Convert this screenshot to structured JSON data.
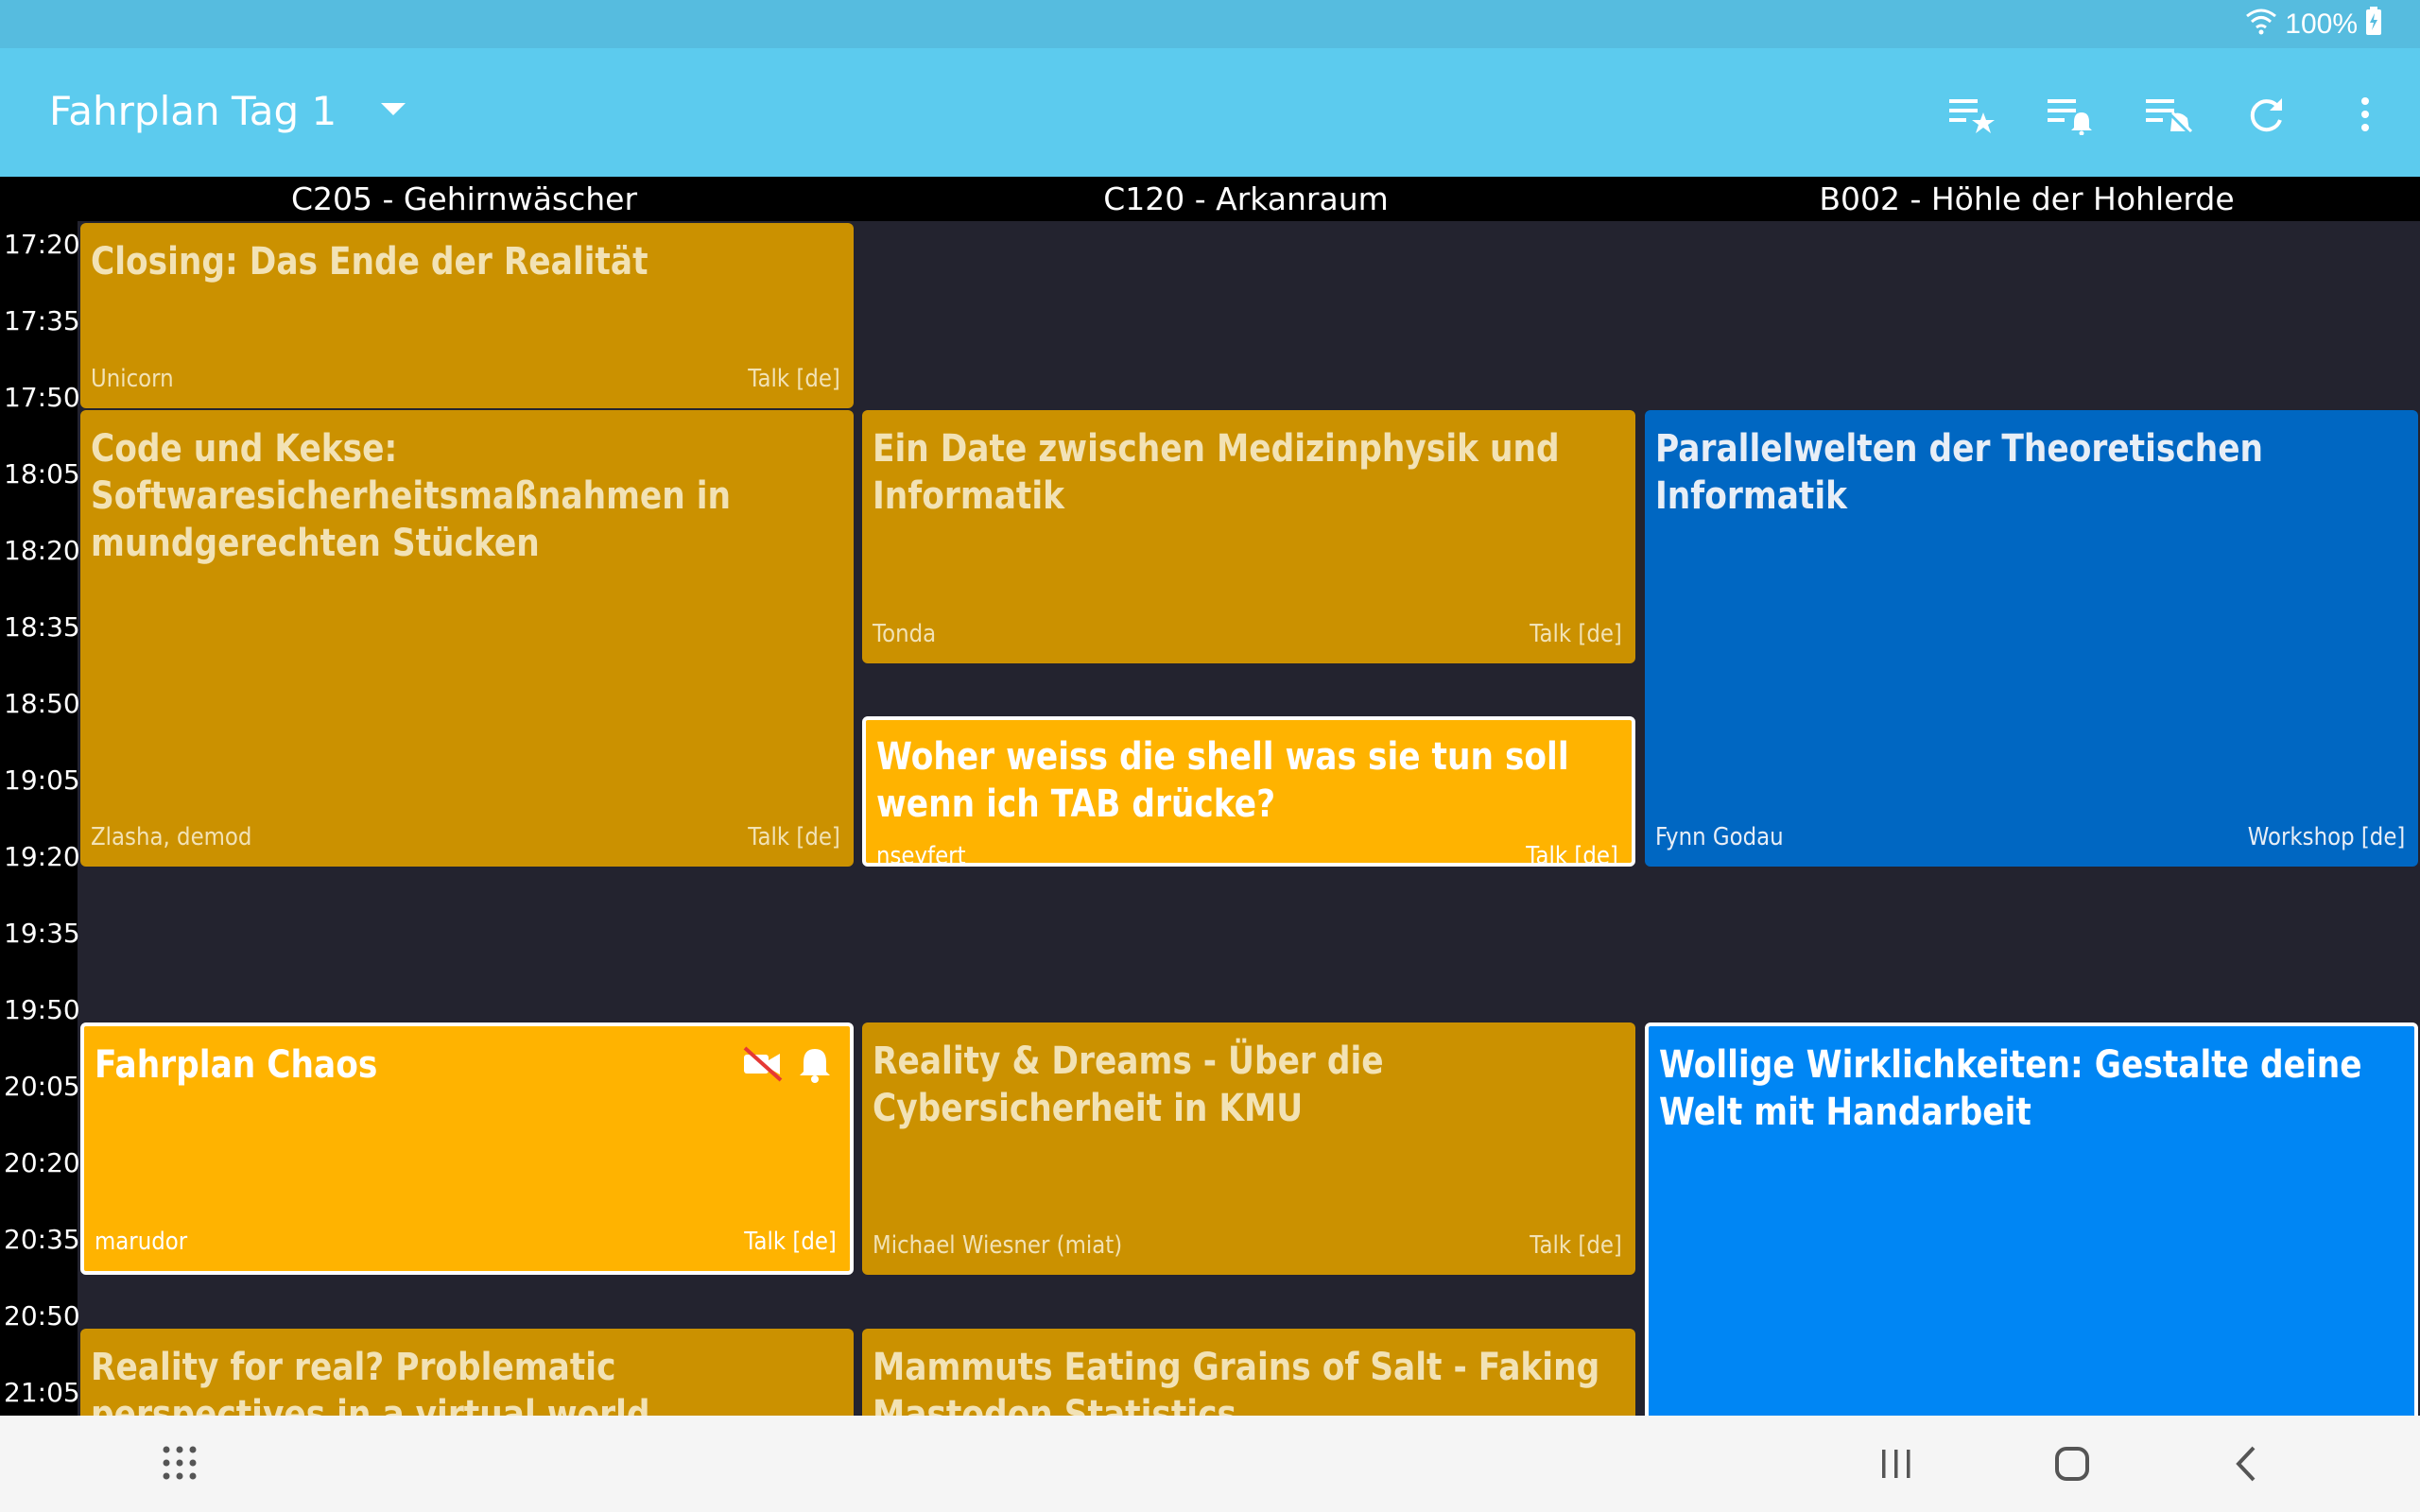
{
  "status_bar": {
    "battery": "100%"
  },
  "app_bar": {
    "title": "Fahrplan",
    "day": "Tag 1",
    "actions": [
      "starred-list-icon",
      "alarm-list-icon",
      "clear-list-icon",
      "refresh-icon",
      "more-icon"
    ]
  },
  "rooms": [
    "C205 - Gehirnwäscher",
    "C120 - Arkanraum",
    "B002 - Höhle der Hohlerde"
  ],
  "times": [
    "17:20",
    "17:35",
    "17:50",
    "18:05",
    "18:20",
    "18:35",
    "18:50",
    "19:05",
    "19:20",
    "19:35",
    "19:50",
    "20:05",
    "20:20",
    "20:35",
    "20:50",
    "21:05"
  ],
  "events": [
    {
      "title": "Closing: Das Ende der Realität",
      "speaker": "Unicorn",
      "type": "Talk [de]"
    },
    {
      "title": "Code und Kekse: Softwaresicherheitsmaßnahmen in mundgerechten Stücken",
      "speaker": "Zlasha, demod",
      "type": "Talk [de]"
    },
    {
      "title": "Ein Date zwischen Medizinphysik und Informatik",
      "speaker": "Tonda",
      "type": "Talk [de]"
    },
    {
      "title": "Woher weiss die shell was sie tun soll wenn ich TAB drücke?",
      "speaker": "nseyfert",
      "type": "Talk [de]"
    },
    {
      "title": "Parallelwelten der Theoretischen Informatik",
      "speaker": "Fynn Godau",
      "type": "Workshop [de]"
    },
    {
      "title": "Fahrplan Chaos",
      "speaker": "marudor",
      "type": "Talk [de]"
    },
    {
      "title": "Reality & Dreams - Über die Cybersicherheit in KMU",
      "speaker": "Michael Wiesner (miat)",
      "type": "Talk [de]"
    },
    {
      "title": "Wollige Wirklichkeiten: Gestalte deine Welt mit Handarbeit",
      "speaker": "",
      "type": ""
    },
    {
      "title": "Reality for real? Problematic perspectives in a virtual world",
      "speaker": "",
      "type": ""
    },
    {
      "title": "Mammuts Eating Grains of Salt - Faking Mastodon Statistics",
      "speaker": "",
      "type": ""
    }
  ],
  "colors": {
    "status_bar": "#56bcdf",
    "app_bar": "#5ccbee",
    "event_dark": "#cb9100",
    "event_highlight": "#ffb300",
    "workshop": "#0067c2",
    "workshop_highlight": "#0086f4",
    "background": "#23232f"
  }
}
